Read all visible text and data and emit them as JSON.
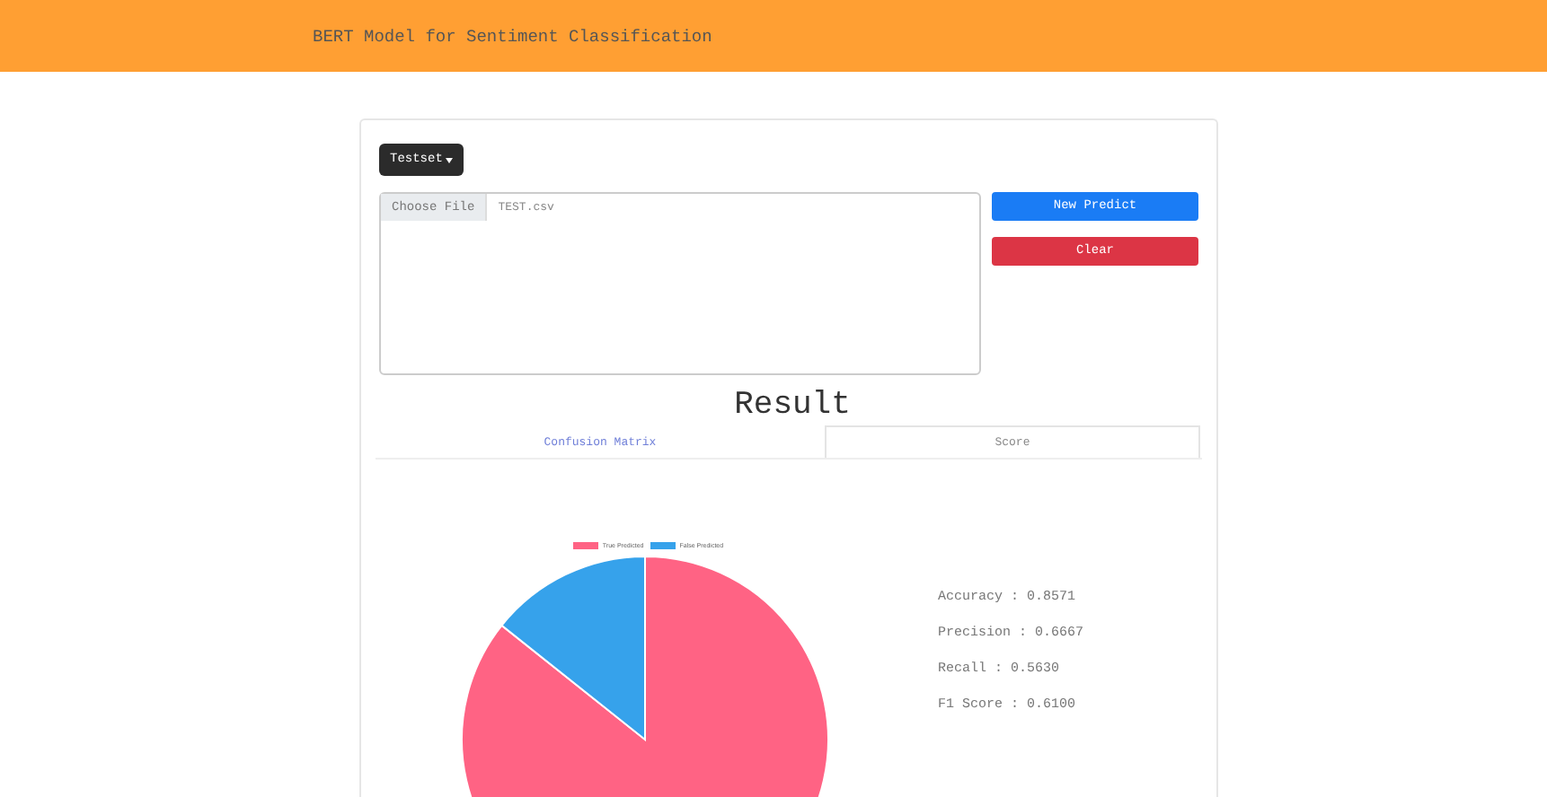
{
  "header": {
    "title": "BERT Model for Sentiment Classification"
  },
  "dataset_dropdown": {
    "label": "Testset"
  },
  "file_input": {
    "button": "Choose File",
    "value": "TEST.csv"
  },
  "buttons": [
    {
      "label": "New Predict",
      "kind": "primary"
    },
    {
      "label": "Clear",
      "kind": "danger"
    }
  ],
  "result": {
    "title": "Result"
  },
  "tabs": [
    {
      "label": "Confusion Matrix",
      "selected": false
    },
    {
      "label": "Score",
      "selected": true
    }
  ],
  "legend": [
    {
      "label": "True Predicted",
      "color": "#ff6384"
    },
    {
      "label": "False Predicted",
      "color": "#36a2eb"
    }
  ],
  "scores": [
    "Accuracy : 0.8571",
    "Precision : 0.6667",
    "Recall : 0.5630",
    "F1 Score : 0.6100"
  ]
}
